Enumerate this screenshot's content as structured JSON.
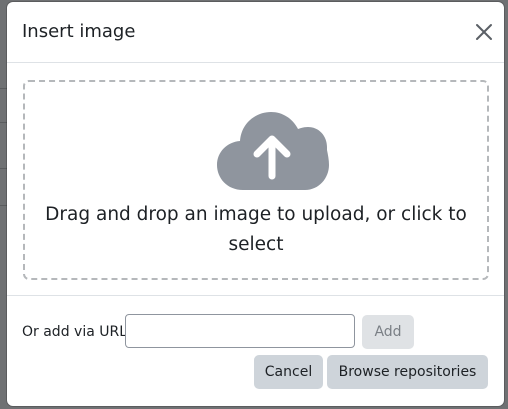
{
  "dialog": {
    "title": "Insert image",
    "close_icon": "close-icon"
  },
  "dropzone": {
    "icon": "cloud-upload-icon",
    "text": "Drag and drop an image to upload, or click to select"
  },
  "url_section": {
    "label": "Or add via URL",
    "input_value": "",
    "input_placeholder": "",
    "add_label": "Add"
  },
  "footer": {
    "cancel_label": "Cancel",
    "browse_label": "Browse repositories"
  },
  "colors": {
    "icon_gray": "#8f959e",
    "button_gray": "#ced4da",
    "text": "#1d2125"
  }
}
